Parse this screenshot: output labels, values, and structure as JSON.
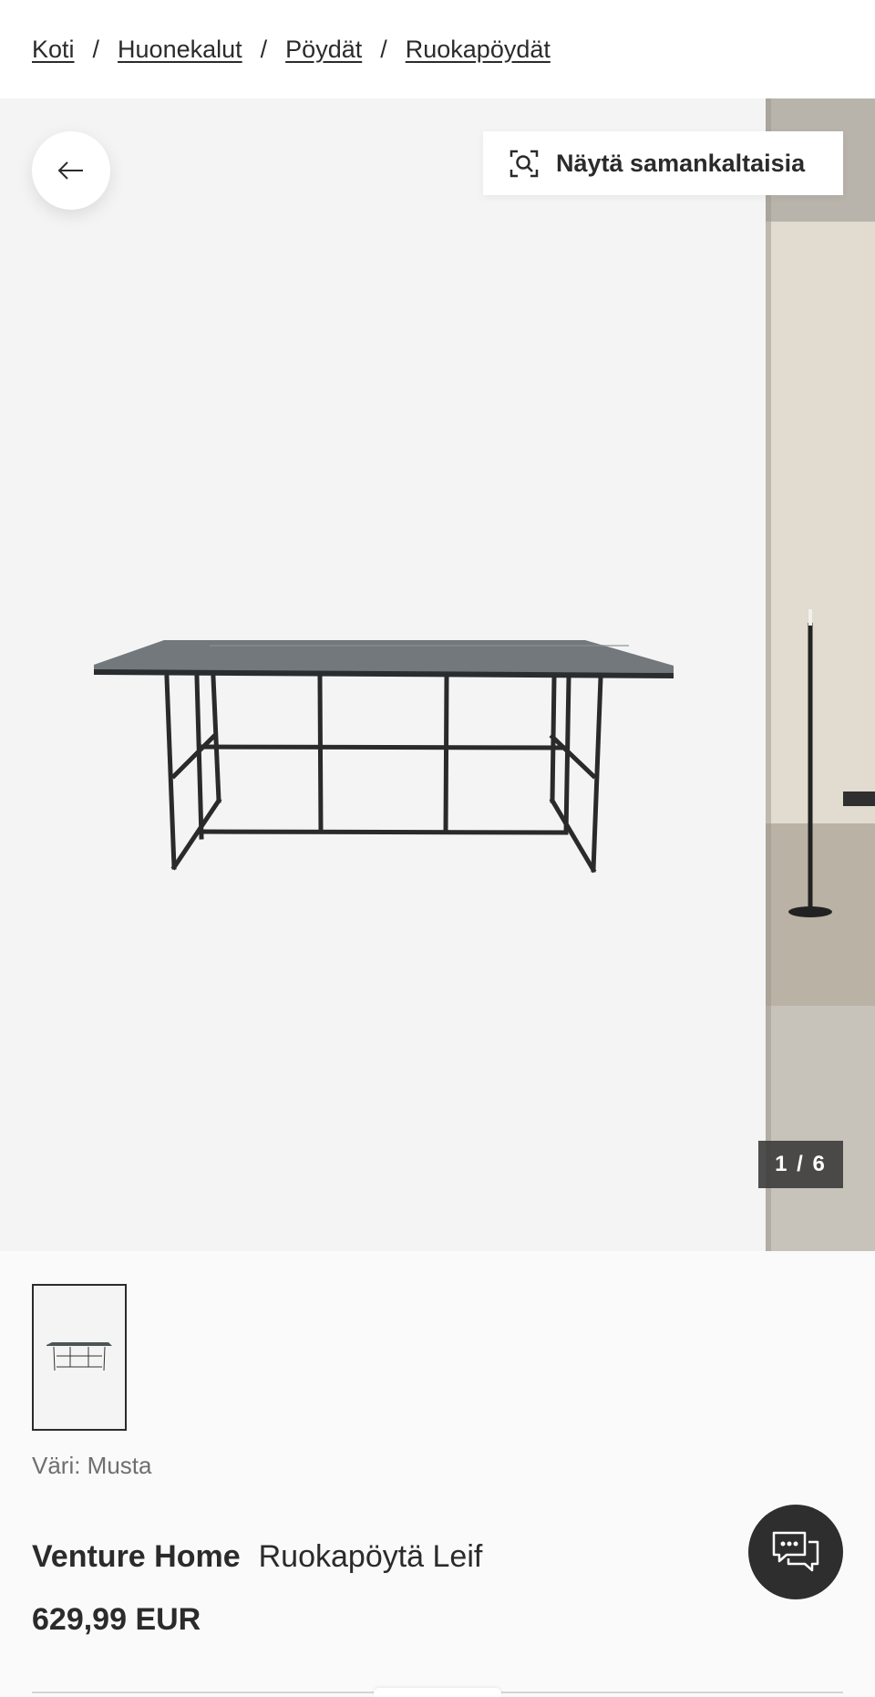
{
  "breadcrumb": {
    "items": [
      "Koti",
      "Huonekalut",
      "Pöydät",
      "Ruokapöydät"
    ],
    "separator": "/"
  },
  "gallery": {
    "similar_label": "Näytä samankaltaisia",
    "counter": "1 / 6",
    "back_icon": "arrow-left-icon",
    "similar_icon": "visual-search-icon"
  },
  "product": {
    "color_label": "Väri: Musta",
    "brand": "Venture Home",
    "name": "Ruokapöytä Leif",
    "price": "629,99 EUR"
  },
  "chat": {
    "icon": "chat-bubbles-icon"
  },
  "colors": {
    "text": "#2b2b2b",
    "muted": "#6f6f6f",
    "chat_bg": "#2e2e2e",
    "gallery_bg": "#f4f4f4"
  }
}
